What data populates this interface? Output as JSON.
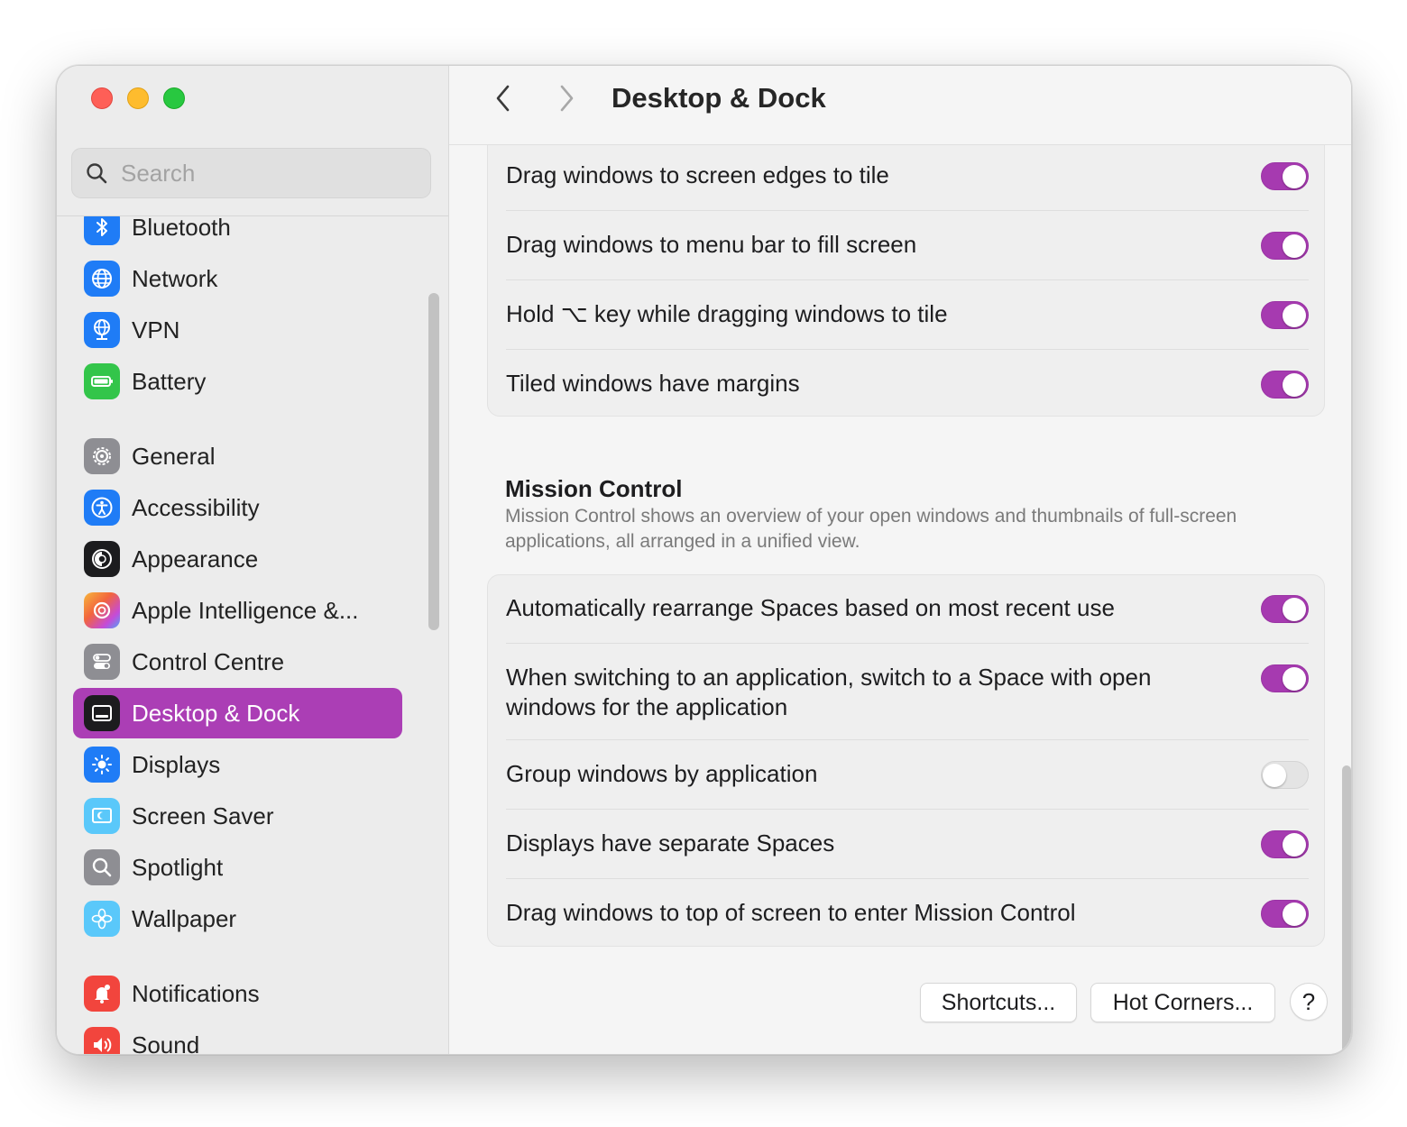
{
  "window": {
    "title": "Desktop & Dock"
  },
  "search": {
    "placeholder": "Search",
    "icon": "magnifier-icon"
  },
  "sidebar": {
    "items": [
      {
        "label": "Bluetooth",
        "icon": "bluetooth-icon",
        "color": "#1f7cf6"
      },
      {
        "label": "Network",
        "icon": "globe-icon",
        "color": "#1f7cf6"
      },
      {
        "label": "VPN",
        "icon": "vpn-globe-icon",
        "color": "#1f7cf6"
      },
      {
        "label": "Battery",
        "icon": "battery-icon",
        "color": "#33c54a"
      },
      {
        "label": "General",
        "icon": "gear-icon",
        "color": "#8e8e93"
      },
      {
        "label": "Accessibility",
        "icon": "accessibility-icon",
        "color": "#1f7cf6"
      },
      {
        "label": "Appearance",
        "icon": "appearance-icon",
        "color": "#1c1c1e"
      },
      {
        "label": "Apple Intelligence &...",
        "icon": "apple-intelligence-icon",
        "color": "#f08a5d"
      },
      {
        "label": "Control Centre",
        "icon": "control-centre-icon",
        "color": "#8e8e93"
      },
      {
        "label": "Desktop & Dock",
        "icon": "dock-icon",
        "color": "#1c1c1e",
        "active": true
      },
      {
        "label": "Displays",
        "icon": "sun-icon",
        "color": "#1f7cf6"
      },
      {
        "label": "Screen Saver",
        "icon": "screen-saver-icon",
        "color": "#5ac8fa"
      },
      {
        "label": "Spotlight",
        "icon": "spotlight-icon",
        "color": "#8e8e93"
      },
      {
        "label": "Wallpaper",
        "icon": "flower-icon",
        "color": "#5ac8fa"
      },
      {
        "label": "Notifications",
        "icon": "bell-icon",
        "color": "#f2453d"
      },
      {
        "label": "Sound",
        "icon": "speaker-icon",
        "color": "#f2453d"
      }
    ]
  },
  "tiling": {
    "rows": [
      {
        "label": "Drag windows to screen edges to tile",
        "on": true
      },
      {
        "label": "Drag windows to menu bar to fill screen",
        "on": true
      },
      {
        "label": "Hold ⌥ key while dragging windows to tile",
        "on": true
      },
      {
        "label": "Tiled windows have margins",
        "on": true
      }
    ]
  },
  "mission_control": {
    "title": "Mission Control",
    "description": "Mission Control shows an overview of your open windows and thumbnails of full-screen applications, all arranged in a unified view.",
    "rows": [
      {
        "label": "Automatically rearrange Spaces based on most recent use",
        "on": true
      },
      {
        "label": "When switching to an application, switch to a Space with open windows for the application",
        "on": true
      },
      {
        "label": "Group windows by application",
        "on": false
      },
      {
        "label": "Displays have separate Spaces",
        "on": true
      },
      {
        "label": "Drag windows to top of screen to enter Mission Control",
        "on": true
      }
    ]
  },
  "buttons": {
    "shortcuts": "Shortcuts...",
    "hot_corners": "Hot Corners...",
    "help": "?"
  },
  "colors": {
    "accent": "#a63ab0",
    "sidebar_active": "#ab3eb5"
  }
}
